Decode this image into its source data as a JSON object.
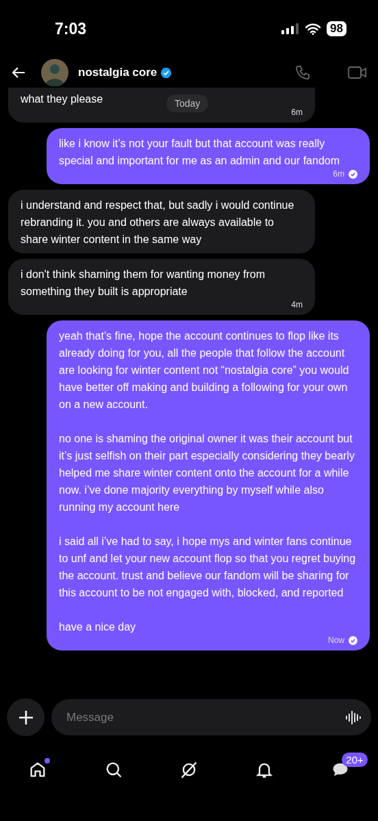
{
  "status_bar": {
    "time": "7:03",
    "battery": "98"
  },
  "header": {
    "name": "nostalgia core",
    "verified": true
  },
  "date_label": "Today",
  "messages": [
    {
      "kind": "received",
      "text": "what they please",
      "time": "6m"
    },
    {
      "kind": "sent",
      "text": "like i know it’s not your fault but that account was really special and important for me as an admin and our fandom",
      "time": "6m",
      "read": true
    },
    {
      "kind": "received",
      "text": "i understand and respect that, but sadly i would continue rebranding it. you and others are always available to share winter content in the same way"
    },
    {
      "kind": "received",
      "text": "i don't think shaming them for wanting money from something they built is appropriate",
      "time": "4m"
    },
    {
      "kind": "sent",
      "text": "yeah that’s fine, hope the account continues to flop like its already doing for you, all the people that follow the account are looking for winter content not “nostalgia core” you would have better off making and building a following for your own on a new account.\n\nno one is shaming the original owner it was their account but it’s just selfish on their part especially considering they bearly helped me share winter content onto the account for a while now. i’ve done majority everything by myself while also running my account here\n\ni said all i’ve had to say, i hope mys and winter fans continue to unf and let your new account flop so that you regret buying the account. trust and believe our fandom will be sharing for this account to be not engaged with, blocked, and reported\n\nhave a nice day",
      "time": "Now",
      "read": true
    }
  ],
  "composer": {
    "placeholder": "Message"
  },
  "nav": {
    "home_dot": true,
    "messages_badge": "20+"
  }
}
